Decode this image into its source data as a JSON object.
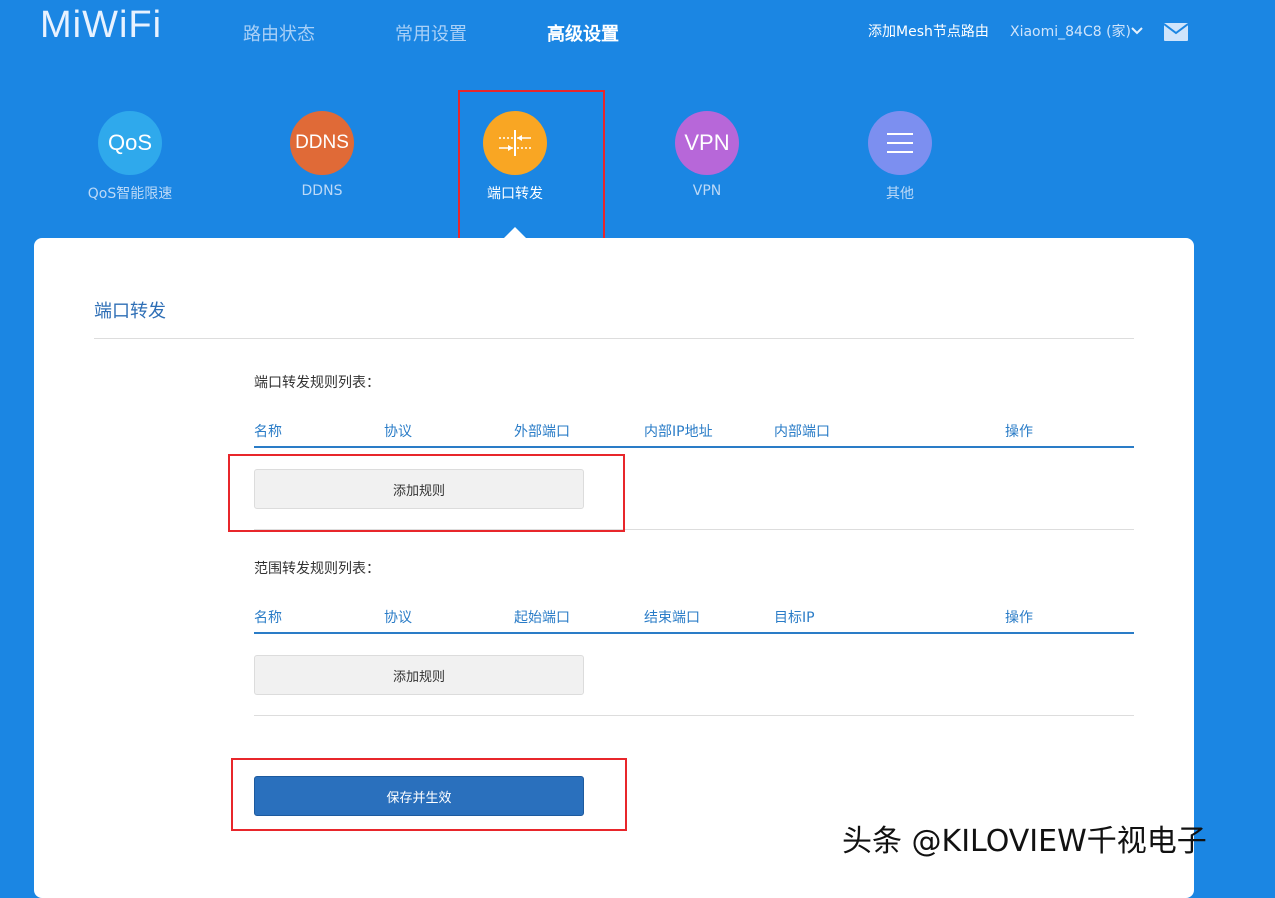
{
  "header": {
    "logo": "MiWiFi",
    "nav": [
      "路由状态",
      "常用设置",
      "高级设置"
    ],
    "active_nav": "高级设置",
    "mesh_link": "添加Mesh节点路由",
    "device": "Xiaomi_84C8 (家)",
    "icons": [
      "chevron-down-icon",
      "mail-icon"
    ]
  },
  "categories": [
    {
      "icon_text": "QoS",
      "label": "QoS智能限速",
      "color": "#2fa9ec"
    },
    {
      "icon_text": "DDNS",
      "label": "DDNS",
      "color": "#e06a37"
    },
    {
      "icon_text": "",
      "label": "端口转发",
      "color": "#f9a623",
      "active": true
    },
    {
      "icon_text": "VPN",
      "label": "VPN",
      "color": "#b767d9"
    },
    {
      "icon_text": "",
      "label": "其他",
      "color": "#7c8ff0"
    }
  ],
  "page": {
    "title": "端口转发",
    "port_section": {
      "title": "端口转发规则列表：",
      "headers": [
        "名称",
        "协议",
        "外部端口",
        "内部IP地址",
        "内部端口",
        "操作"
      ],
      "add_label": "添加规则"
    },
    "range_section": {
      "title": "范围转发规则列表：",
      "headers": [
        "名称",
        "协议",
        "起始端口",
        "结束端口",
        "目标IP",
        "操作"
      ],
      "add_label": "添加规则"
    },
    "save_label": "保存并生效"
  },
  "watermark": "头条 @KILOVIEW千视电子",
  "colors": {
    "background": "#1b86e3",
    "accent": "#2a7cc7",
    "highlight": "#e8262b"
  }
}
